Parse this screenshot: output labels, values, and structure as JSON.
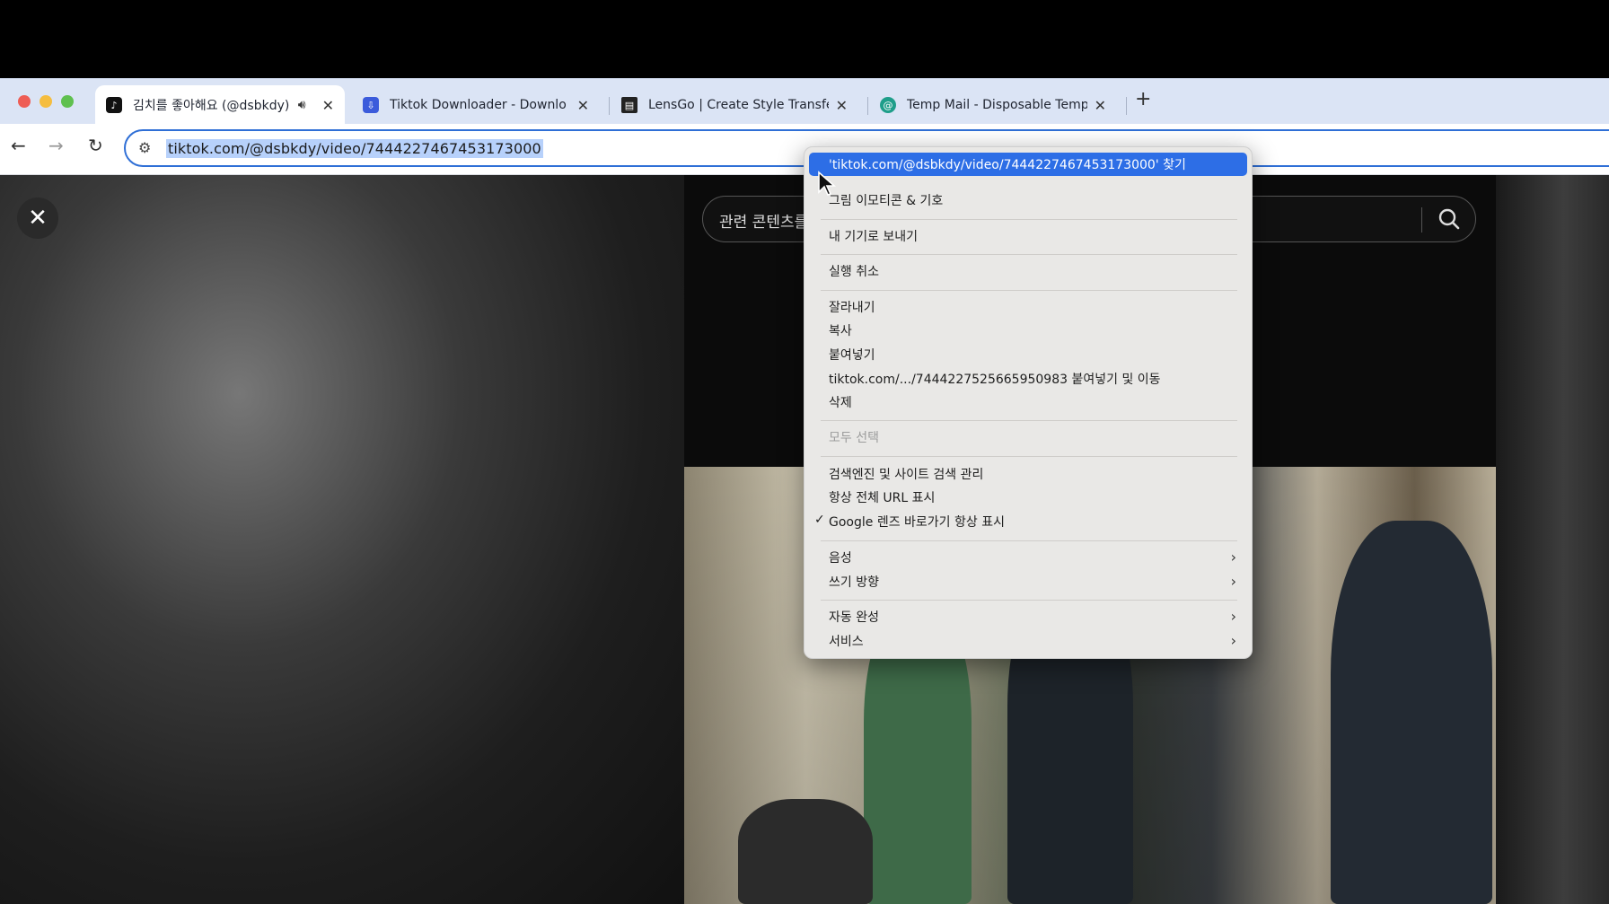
{
  "browser": {
    "tabs": [
      {
        "title": "김치를 좋아해요 (@dsbkdy)",
        "active": true,
        "favicon": "tiktok-icon"
      },
      {
        "title": "Tiktok Downloader - Downlo",
        "active": false,
        "favicon": "download-icon"
      },
      {
        "title": "LensGo | Create Style Transfe",
        "active": false,
        "favicon": "lensgo-icon"
      },
      {
        "title": "Temp Mail - Disposable Temp",
        "active": false,
        "favicon": "tempmail-icon"
      }
    ],
    "new_tab": "+",
    "url": "tiktok.com/@dsbkdy/video/7444227467453173000"
  },
  "page": {
    "search_placeholder": "관련 콘텐츠를"
  },
  "context_menu": {
    "items": [
      {
        "label": "'tiktok.com/@dsbkdy/video/7444227467453173000' 찾기",
        "state": "highlight"
      },
      {
        "label": "그림 이모티콘 & 기호"
      },
      {
        "label": "내 기기로 보내기"
      },
      {
        "label": "실행 취소"
      },
      {
        "label": "잘라내기"
      },
      {
        "label": "복사"
      },
      {
        "label": "붙여넣기"
      },
      {
        "label": "tiktok.com/.../7444227525665950983 붙여넣기 및 이동"
      },
      {
        "label": "삭제"
      },
      {
        "label": "모두 선택",
        "state": "disabled"
      },
      {
        "label": "검색엔진 및 사이트 검색 관리"
      },
      {
        "label": "항상 전체 URL 표시"
      },
      {
        "label": "Google 렌즈 바로가기 항상 표시",
        "checked": true
      },
      {
        "label": "음성",
        "submenu": true
      },
      {
        "label": "쓰기 방향",
        "submenu": true
      },
      {
        "label": "자동 완성",
        "submenu": true
      },
      {
        "label": "서비스",
        "submenu": true
      }
    ]
  },
  "colors": {
    "accent": "#2d6ee6",
    "tabstrip": "#dbe4f5",
    "url_selection": "#b7d1fb"
  }
}
